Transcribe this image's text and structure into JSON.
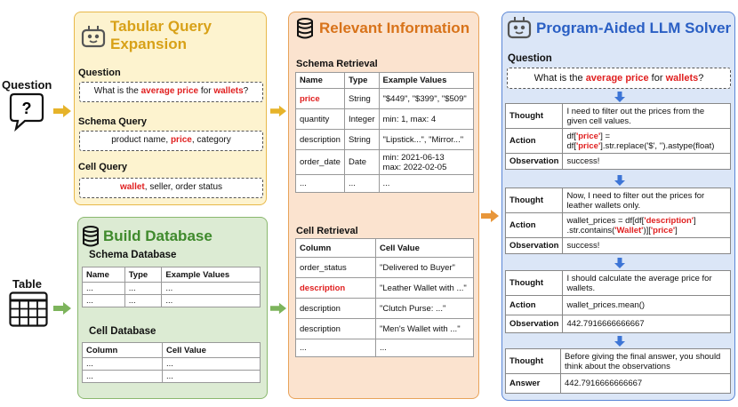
{
  "left": {
    "question_label": "Question",
    "table_label": "Table"
  },
  "expansion": {
    "title_line1": "Tabular Query",
    "title_line2": "Expansion",
    "question_label": "Question",
    "question_parts": [
      "What is the ",
      "average price",
      " for ",
      "wallets",
      "?"
    ],
    "schema_label": "Schema Query",
    "schema_parts": [
      "product name, ",
      "price",
      ", category"
    ],
    "cell_label": "Cell Query",
    "cell_parts": [
      "wallet",
      ", seller, order status"
    ]
  },
  "build": {
    "title": "Build Database",
    "schema_db_label": "Schema Database",
    "schema_headers": [
      "Name",
      "Type",
      "Example Values"
    ],
    "schema_rows": [
      [
        "...",
        "...",
        "..."
      ],
      [
        "...",
        "...",
        "..."
      ]
    ],
    "cell_db_label": "Cell Database",
    "cell_headers": [
      "Column",
      "Cell Value"
    ],
    "cell_rows": [
      [
        "...",
        "..."
      ],
      [
        "...",
        "..."
      ]
    ]
  },
  "relevant": {
    "title": "Relevant Information",
    "schema_label": "Schema Retrieval",
    "schema_headers": [
      "Name",
      "Type",
      "Example Values"
    ],
    "schema_rows": [
      [
        "price",
        "String",
        "\"$449\", \"$399\", \"$509\""
      ],
      [
        "quantity",
        "Integer",
        "min: 1, max: 4"
      ],
      [
        "description",
        "String",
        "\"Lipstick...\", \"Mirror...\""
      ],
      [
        "order_date",
        "Date",
        "min: 2021-06-13\nmax: 2022-02-05"
      ],
      [
        "...",
        "...",
        "..."
      ]
    ],
    "cell_label": "Cell Retrieval",
    "cell_headers": [
      "Column",
      "Cell Value"
    ],
    "cell_rows": [
      [
        "order_status",
        "\"Delivered to Buyer\""
      ],
      [
        "description",
        "\"Leather Wallet with ...\""
      ],
      [
        "description",
        "\"Clutch Purse: ...\""
      ],
      [
        "description",
        "\"Men's Wallet with ...\""
      ],
      [
        "...",
        "..."
      ]
    ]
  },
  "solver": {
    "title": "Program-Aided LLM Solver",
    "question_label": "Question",
    "question_parts": [
      "What is the ",
      "average price",
      " for ",
      "wallets",
      "?"
    ],
    "steps": [
      {
        "k1": "Thought",
        "v1": "I need to filter out the prices from the given cell values.",
        "k2": "Action",
        "k3": "Observation",
        "v3": "success!"
      },
      {
        "k1": "Thought",
        "v1": "Now, I need to filter out the prices for leather wallets only.",
        "k2": "Action",
        "k3": "Observation",
        "v3": "success!"
      },
      {
        "k1": "Thought",
        "v1": "I should calculate the average price for wallets.",
        "k2": "Action",
        "v2": "wallet_prices.mean()",
        "k3": "Observation",
        "v3": "442.7916666666667"
      },
      {
        "k1": "Thought",
        "v1": "Before giving the final answer, you should think about the observations",
        "k2": "Answer",
        "v2": "442.7916666666667"
      }
    ]
  }
}
